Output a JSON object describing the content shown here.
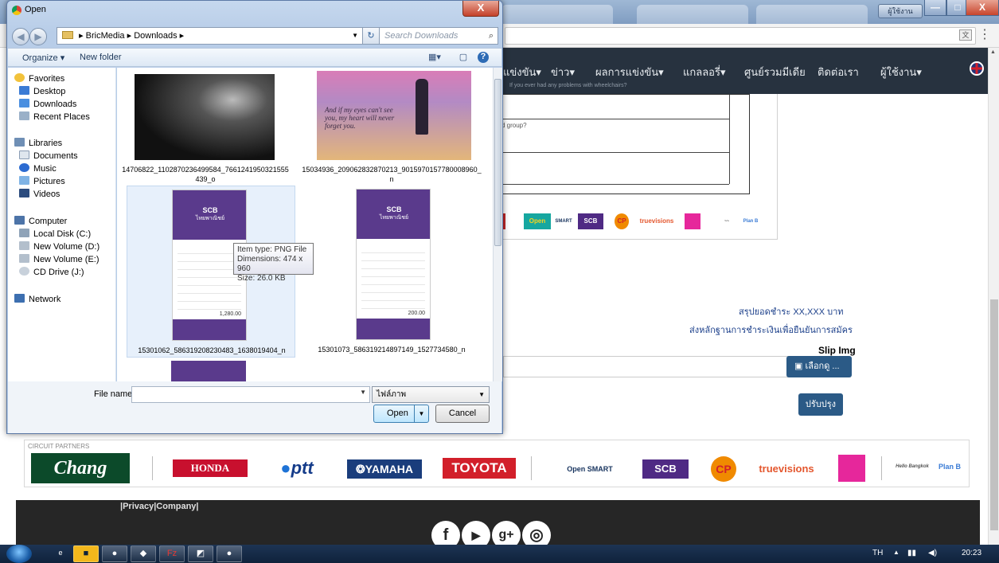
{
  "browser": {
    "user_badge": "ผู้ใช้งาน",
    "window_controls": {
      "minimize": "—",
      "maximize": "□",
      "close": "X"
    }
  },
  "site": {
    "nav": [
      "แข่งขัน▾",
      "ข่าว▾",
      "ผลการแข่งขัน▾",
      "แกลลอรี่▾",
      "ศูนย์รวมมีเดีย",
      "ติดต่อเรา",
      "ผู้ใช้งาน▾"
    ],
    "nav_hint": "If you ever had any problems with wheelchairs?",
    "group_question": "d group?",
    "summary": "สรุปยอดชำระ XX,XXX บาท",
    "proof": "ส่งหลักฐานการชำระเงินเพื่อยืนยันการสมัคร",
    "slip_label": "Slip Img",
    "choose_button": "เลือกดู ...",
    "update_button": "ปรับปรุง",
    "partners_title": "CIRCUIT PARTNERS",
    "partners": [
      "Chang",
      "HONDA",
      "ptt",
      "YAMAHA",
      "TOYOTA",
      "Open SMART",
      "SCB",
      "CP",
      "truevisions",
      "Hello Bangkok",
      "Plan B"
    ],
    "mini_partners": [
      "Open",
      "SMART",
      "SCB",
      "CP",
      "truevisions",
      "Plan B"
    ],
    "footer_links": "|Privacy|Company|",
    "social": [
      "f",
      "▶",
      "g+",
      "◎"
    ],
    "colors": {
      "nav_bg": "#27323f",
      "button_blue": "#2b5a86",
      "link_blue": "#1b3f8a",
      "footer_bg": "#262626"
    }
  },
  "dialog": {
    "title": "Open",
    "close_label": "X",
    "breadcrumb": [
      "BricMedia",
      "Downloads"
    ],
    "search_placeholder": "Search Downloads",
    "organize": "Organize ▾",
    "new_folder": "New folder",
    "nav_pane": {
      "favorites": {
        "label": "Favorites",
        "items": [
          "Desktop",
          "Downloads",
          "Recent Places"
        ]
      },
      "libraries": {
        "label": "Libraries",
        "items": [
          "Documents",
          "Music",
          "Pictures",
          "Videos"
        ]
      },
      "computer": {
        "label": "Computer",
        "items": [
          "Local Disk (C:)",
          "New Volume (D:)",
          "New Volume (E:)",
          "CD Drive (J:)"
        ]
      },
      "network": {
        "label": "Network"
      }
    },
    "files": [
      {
        "name": "14706822_1102870236499584_7661241950321555439_o"
      },
      {
        "name": "15034936_209062832870213_9015970157780008960_n",
        "overlay_text": "And if my eyes can't see you, my heart will never forget you."
      },
      {
        "name": "15301062_586319208230483_1638019404_n",
        "brand": "SCB",
        "brand_sub": "ไทยพาณิชย์",
        "amount": "1,280.00"
      },
      {
        "name": "15301073_586319214897149_1527734580_n",
        "brand": "SCB",
        "brand_sub": "ไทยพาณิชย์",
        "amount": "200.00"
      }
    ],
    "tooltip": {
      "type": "Item type: PNG File",
      "dimensions": "Dimensions: 474 x 960",
      "size": "Size: 26.0 KB"
    },
    "file_name_label": "File name:",
    "file_name_value": "",
    "file_type": "ไฟล์ภาพ",
    "open_button": "Open",
    "cancel_button": "Cancel"
  },
  "taskbar": {
    "lang": "TH",
    "clock": "20:23"
  }
}
